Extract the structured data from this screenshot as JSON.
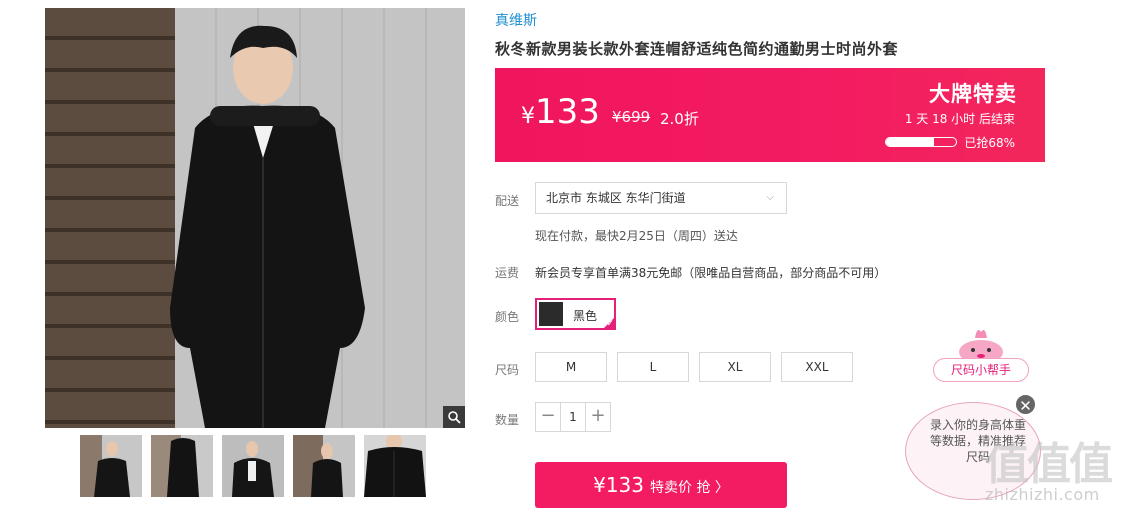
{
  "product": {
    "brand": "真维斯",
    "title": "秋冬新款男装长款外套连帽舒适纯色简约通勤男士时尚外套"
  },
  "price": {
    "currency": "¥",
    "current": "133",
    "original": "¥699",
    "discount": "2.0折",
    "sale_label": "大牌特卖",
    "countdown": "1 天 18 小时 后结束",
    "sold_percent": 68,
    "sold_text": "已抢68%"
  },
  "delivery": {
    "label": "配送",
    "location": "北京市 东城区 东华门街道",
    "eta": "现在付款，最快2月25日（周四）送达"
  },
  "shipping": {
    "label": "运费",
    "text": "新会员专享首单满38元免邮（限唯品自营商品，部分商品不可用）"
  },
  "color": {
    "label": "颜色",
    "selected": "黑色"
  },
  "size": {
    "label": "尺码",
    "options": [
      "M",
      "L",
      "XL",
      "XXL"
    ]
  },
  "quantity": {
    "label": "数量",
    "value": "1",
    "minus": "−",
    "plus": "+"
  },
  "buy": {
    "price": "¥133",
    "label": "特卖价 抢 〉"
  },
  "size_helper": {
    "tag": "尺码小帮手",
    "text": "录入你的身高体重等数据，精准推荐尺码",
    "close": "✕"
  },
  "watermark": {
    "logo": "值值值",
    "site": "zhizhizhi.com"
  },
  "colors": {
    "accent": "#f31b61",
    "brand_link": "#1f8fd1",
    "select_border": "#e5207b"
  }
}
